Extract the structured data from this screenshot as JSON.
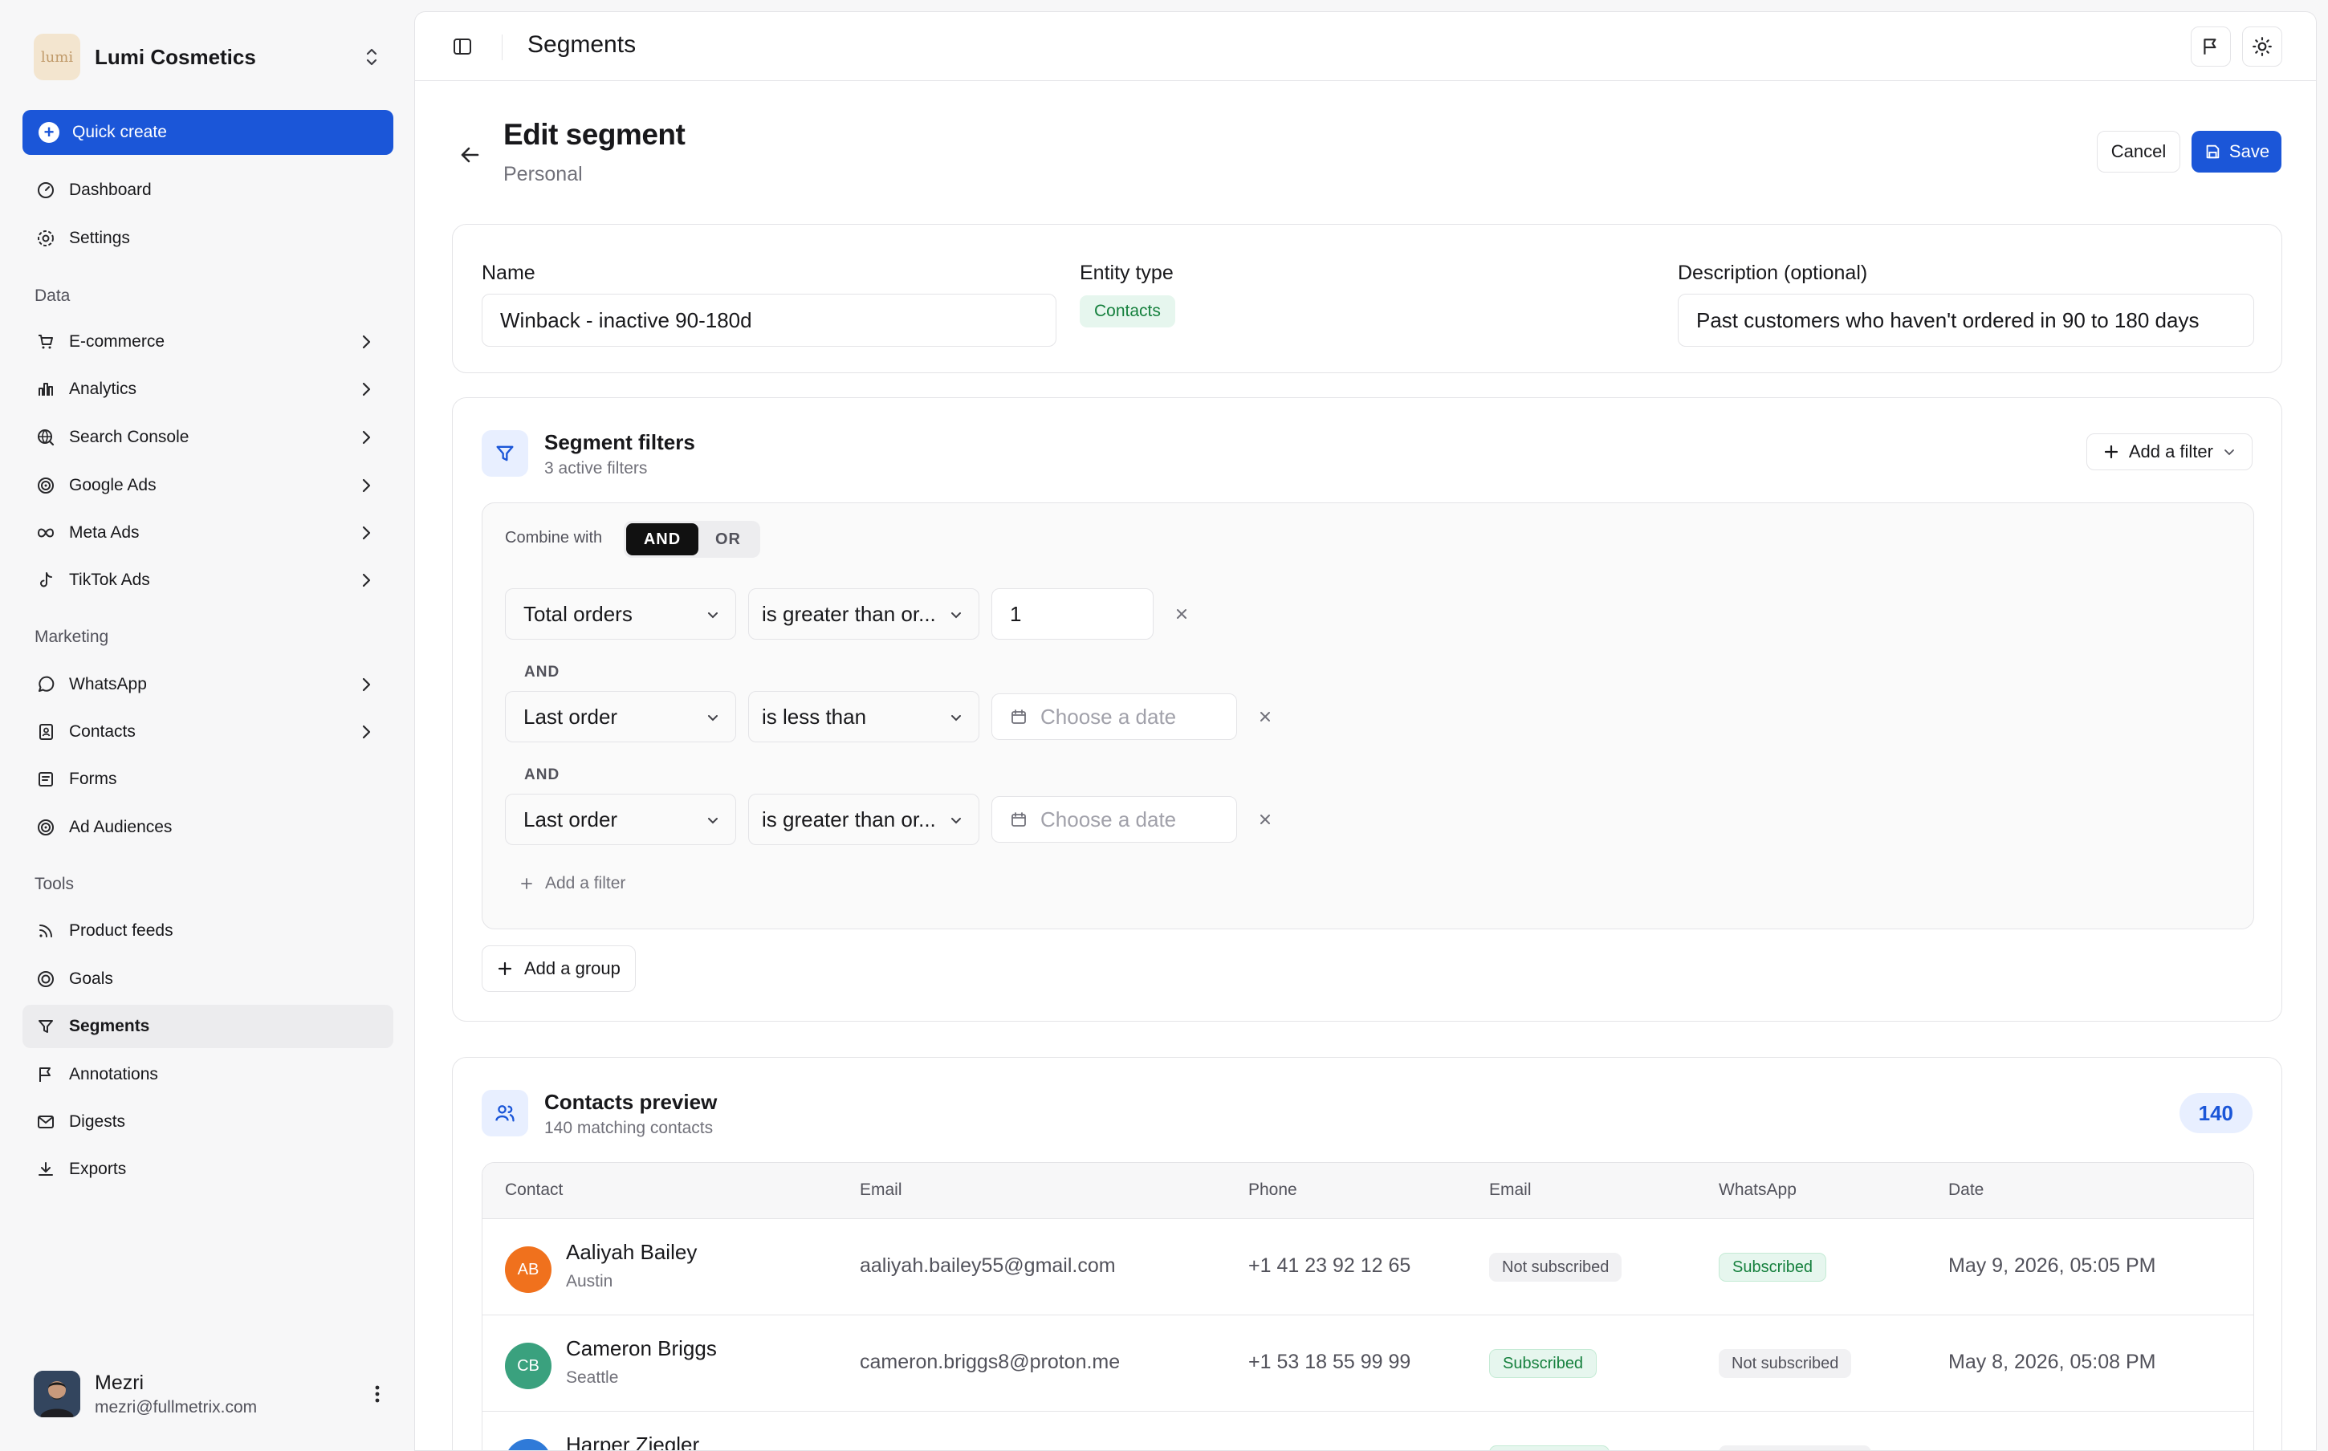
{
  "brand": {
    "logo_text": "lumi",
    "name": "Lumi Cosmetics"
  },
  "sidebar": {
    "quick_create": "Quick create",
    "top_items": [
      {
        "label": "Dashboard",
        "icon": "gauge-icon"
      },
      {
        "label": "Settings",
        "icon": "gear-icon"
      }
    ],
    "sections": [
      {
        "label": "Data",
        "items": [
          "E-commerce",
          "Analytics",
          "Search Console",
          "Google Ads",
          "Meta Ads",
          "TikTok Ads"
        ]
      },
      {
        "label": "Marketing",
        "items": [
          "WhatsApp",
          "Contacts",
          "Forms",
          "Ad Audiences"
        ]
      },
      {
        "label": "Tools",
        "items": [
          "Product feeds",
          "Goals",
          "Segments",
          "Annotations",
          "Digests",
          "Exports"
        ]
      }
    ],
    "active_item": "Segments"
  },
  "user": {
    "name": "Mezri",
    "email": "mezri@fullmetrix.com"
  },
  "topbar": {
    "title": "Segments"
  },
  "page": {
    "title": "Edit segment",
    "subtitle": "Personal",
    "cancel": "Cancel",
    "save": "Save"
  },
  "details": {
    "name_label": "Name",
    "name_value": "Winback - inactive 90-180d",
    "entity_label": "Entity type",
    "entity_value": "Contacts",
    "desc_label": "Description (optional)",
    "desc_value": "Past customers who haven't ordered in 90 to 180 days"
  },
  "filters": {
    "title": "Segment filters",
    "subtitle": "3 active filters",
    "add_filter": "Add a filter",
    "combine_label": "Combine with",
    "and": "AND",
    "or": "OR",
    "rows": [
      {
        "field": "Total orders",
        "operator": "is greater than or...",
        "value": "1"
      },
      {
        "field": "Last order",
        "operator": "is less than",
        "placeholder": "Choose a date"
      },
      {
        "field": "Last order",
        "operator": "is greater than or...",
        "placeholder": "Choose a date"
      }
    ],
    "joiner": "AND",
    "add_filter_inner": "Add a filter",
    "add_group": "Add a group"
  },
  "preview": {
    "title": "Contacts preview",
    "subtitle": "140 matching contacts",
    "count": "140",
    "columns": [
      "Contact",
      "Email",
      "Phone",
      "Email",
      "WhatsApp",
      "Date"
    ],
    "rows": [
      {
        "initials": "AB",
        "name": "Aaliyah Bailey",
        "city": "Austin",
        "email": "aaliyah.bailey55@gmail.com",
        "phone": "+1 41 23 92 12 65",
        "email_status": "Not subscribed",
        "whatsapp_status": "Subscribed",
        "date": "May 9, 2026, 05:05 PM",
        "color": "#f0711d"
      },
      {
        "initials": "CB",
        "name": "Cameron Briggs",
        "city": "Seattle",
        "email": "cameron.briggs8@proton.me",
        "phone": "+1 53 18 55 99 99",
        "email_status": "Subscribed",
        "whatsapp_status": "Not subscribed",
        "date": "May 8, 2026, 05:08 PM",
        "color": "#3aa17e"
      },
      {
        "initials": "HZ",
        "name": "Harper Ziegler",
        "color": "#2f7ad8"
      }
    ]
  },
  "colors": {
    "accent": "#1b56d8",
    "success": "#15803d"
  }
}
